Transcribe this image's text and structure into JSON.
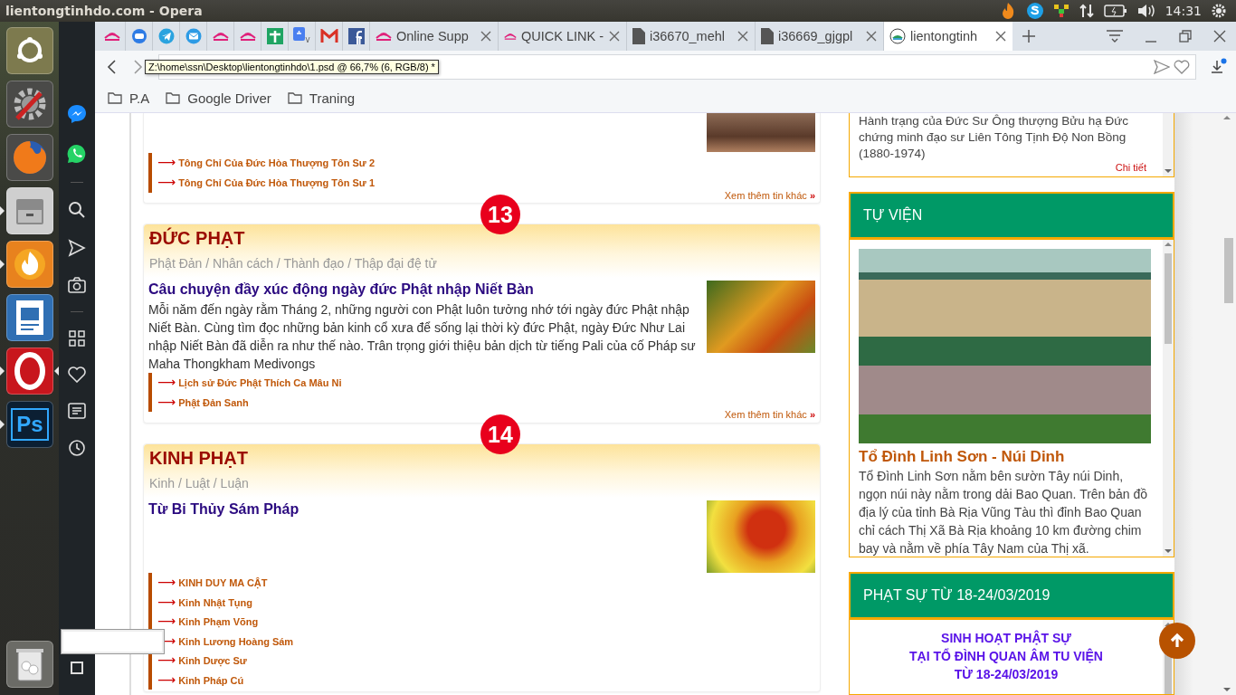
{
  "top_panel": {
    "title": "lientongtinhdo.com - Opera",
    "clock": "14:31",
    "tray": [
      {
        "kind": "flame"
      },
      {
        "kind": "skype"
      },
      {
        "kind": "vpn"
      },
      {
        "kind": "network"
      },
      {
        "kind": "battery"
      },
      {
        "kind": "volume"
      },
      {
        "kind": "power"
      }
    ]
  },
  "launcher": [
    {
      "kind": "dash",
      "running": false,
      "active": false
    },
    {
      "kind": "settings",
      "running": false,
      "active": false
    },
    {
      "kind": "firefox",
      "running": false,
      "active": false
    },
    {
      "kind": "files",
      "running": true,
      "active": false
    },
    {
      "kind": "flame",
      "running": true,
      "active": false
    },
    {
      "kind": "impress",
      "running": false,
      "active": false
    },
    {
      "kind": "opera",
      "running": true,
      "active": true
    },
    {
      "kind": "photoshop",
      "running": true,
      "active": false,
      "label": "Ps"
    }
  ],
  "opera_sidebar": [
    {
      "kind": "messenger"
    },
    {
      "kind": "whatsapp"
    },
    {
      "kind": "separator"
    },
    {
      "kind": "search"
    },
    {
      "kind": "send"
    },
    {
      "kind": "camera"
    },
    {
      "kind": "separator"
    },
    {
      "kind": "grid"
    },
    {
      "kind": "heart"
    },
    {
      "kind": "news"
    },
    {
      "kind": "history"
    }
  ],
  "tabs": [
    {
      "kind": "lotus",
      "selected": false
    },
    {
      "kind": "zalo",
      "selected": false
    },
    {
      "kind": "telegram",
      "selected": false
    },
    {
      "kind": "mail",
      "selected": false
    },
    {
      "kind": "lotus",
      "selected": false
    },
    {
      "kind": "lotus",
      "selected": false
    },
    {
      "kind": "cross",
      "selected": false
    },
    {
      "kind": "translate",
      "selected": false
    },
    {
      "kind": "gmail",
      "selected": false
    },
    {
      "kind": "facebook",
      "selected": false
    },
    {
      "kind": "lotus",
      "label": "Online Supp",
      "selected": false
    },
    {
      "kind": "lotus",
      "label": "QUICK LINK -",
      "selected": false
    },
    {
      "kind": "file",
      "label": "i36670_mehl",
      "selected": false
    },
    {
      "kind": "file",
      "label": "i36669_gjgpl",
      "selected": false
    },
    {
      "kind": "site",
      "label": "lientongtinh",
      "selected": true
    }
  ],
  "tooltip": "Z:\\home\\ssn\\Desktop\\lientongtinhdo\\1.psd @ 66,7% (6, RGB/8) *",
  "bookmarks": [
    "P.A",
    "Google Driver",
    "Traning"
  ],
  "top_card": {
    "links": [
      {
        "arrow": "⟶",
        "label": "Tông Chỉ Của Đức Hòa Thượng Tôn Sư 2"
      },
      {
        "arrow": "⟶",
        "label": "Tông Chỉ Của Đức Hòa Thượng Tôn Sư 1"
      }
    ],
    "more": {
      "label": "Xem thêm tin khác",
      "mark": "»"
    }
  },
  "sections": [
    {
      "badge": "13",
      "title": "ĐỨC PHẠT",
      "breadcrumb": "Phật Đản / Nhân cách / Thành đạo / Thập đại đệ tử",
      "article_title": "Câu chuyện đầy xúc động ngày đức Phật nhập Niết Bàn",
      "summary": "Mỗi năm đến ngày rằm Tháng 2, những người con Phật luôn tưởng nhớ tới ngày đức Phật nhập Niết Bàn. Cùng tìm đọc những bản kinh cổ xưa để sống lại thời kỳ đức Phật, ngày Đức Như Lai nhập Niết Bàn đã diễn ra như thế nào. Trân trọng giới thiệu bản dịch từ tiếng Pali của cố Pháp sư Maha Thongkham Medivongs",
      "links": [
        {
          "arrow": "⟶",
          "label": "Lịch sử Đức Phật Thích Ca Mâu Ni"
        },
        {
          "arrow": "⟶",
          "label": "Phật Đản Sanh"
        }
      ],
      "more": {
        "label": "Xem thêm tin khác",
        "mark": "»"
      }
    },
    {
      "badge": "14",
      "title": "KINH PHẠT",
      "breadcrumb": "Kinh / Luật / Luận",
      "article_title": "Từ Bi Thủy Sám Pháp",
      "links": [
        {
          "arrow": "⟶",
          "label": "KINH DUY MA CẬT"
        },
        {
          "arrow": "⟶",
          "label": "Kinh Nhật Tụng"
        },
        {
          "arrow": "⟶",
          "label": "Kinh Phạm Võng"
        },
        {
          "arrow": "⟶",
          "label": "Kinh Lương Hoàng Sám"
        },
        {
          "arrow": "⟶",
          "label": "Kinh Dược Sư"
        },
        {
          "arrow": "⟶",
          "label": "Kinh Pháp Cú"
        }
      ]
    }
  ],
  "sidebar": [
    {
      "kind": "text",
      "text": "Hành trạng của Đức Sư Ông thượng Bửu hạ Đức chứng minh đạo sư Liên Tông Tịnh Độ Non Bồng (1880-1974)",
      "link": "Chi tiết"
    },
    {
      "kind": "photo",
      "title": "TỰ VIỆN",
      "caption": "Tổ Đình Linh Sơn - Núi Dinh",
      "text": "Tổ Đình Linh Sơn nằm bên sườn Tây núi Dinh, ngọn núi này nằm trong dải Bao Quan. Trên bản đồ địa lý của tỉnh Bà Rịa Vũng Tàu thì đỉnh Bao Quan chỉ cách Thị Xã Bà Rịa khoảng 10 km đường chim bay và nằm về phía Tây Nam của Thị xã."
    },
    {
      "kind": "notice",
      "title": "PHẠT SỰ TỪ 18-24/03/2019",
      "lines": [
        "SINH HOẠT PHẬT SỰ",
        "TẠI TỔ ĐÌNH QUAN ÂM TU VIỆN",
        "TỪ 18-24/03/2019"
      ]
    }
  ]
}
